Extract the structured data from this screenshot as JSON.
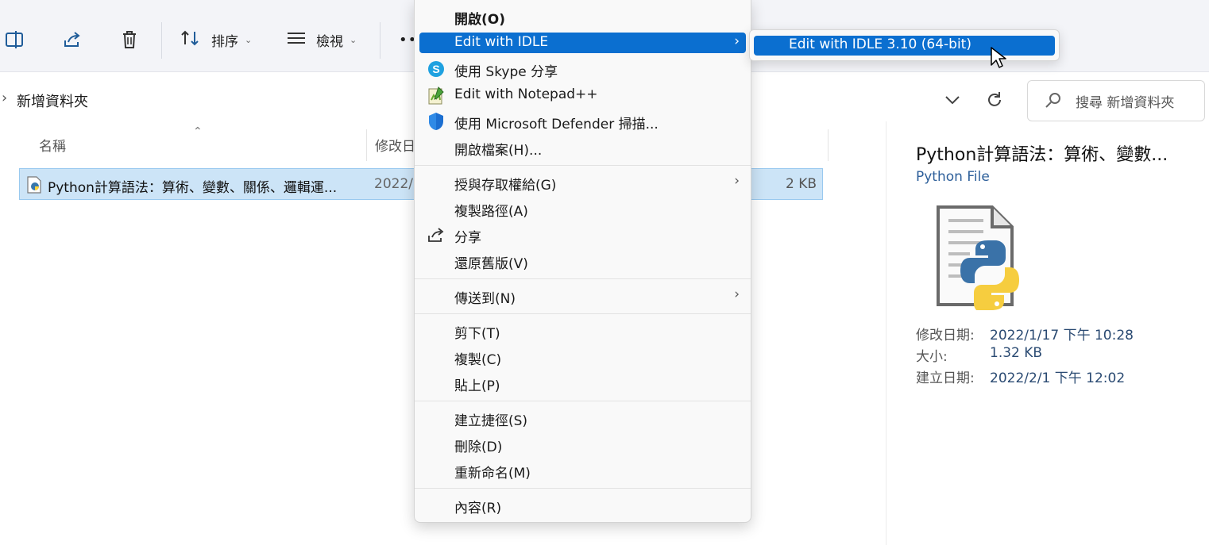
{
  "toolbar": {
    "sort_label": "排序",
    "view_label": "檢視",
    "more_label": "••"
  },
  "address": {
    "separator": "›",
    "path": "新增資料夾"
  },
  "search": {
    "placeholder": "搜尋 新增資料夾"
  },
  "columns": {
    "name": "名稱",
    "modified": "修改日"
  },
  "file": {
    "name": "Python計算語法：算術、變數、關係、邏輯運...",
    "date": "2022/",
    "size": "2 KB"
  },
  "context_menu": {
    "items": [
      {
        "label": "開啟(O)"
      },
      {
        "label": "Edit with IDLE"
      },
      {
        "label": "使用 Skype 分享"
      },
      {
        "label": "Edit with Notepad++"
      },
      {
        "label": "使用 Microsoft Defender 掃描..."
      },
      {
        "label": "開啟檔案(H)..."
      },
      {
        "label": "授與存取權給(G)"
      },
      {
        "label": "複製路徑(A)"
      },
      {
        "label": "分享"
      },
      {
        "label": "還原舊版(V)"
      },
      {
        "label": "傳送到(N)"
      },
      {
        "label": "剪下(T)"
      },
      {
        "label": "複製(C)"
      },
      {
        "label": "貼上(P)"
      },
      {
        "label": "建立捷徑(S)"
      },
      {
        "label": "刪除(D)"
      },
      {
        "label": "重新命名(M)"
      },
      {
        "label": "內容(R)"
      }
    ],
    "submenu_arrow": "›"
  },
  "submenu": {
    "item": "Edit with IDLE 3.10 (64-bit)"
  },
  "preview": {
    "title": "Python計算語法：算術、變數...",
    "type": "Python File",
    "modified_key": "修改日期:",
    "modified_val": "2022/1/17 下午 10:28",
    "size_key": "大小:",
    "size_val": "1.32 KB",
    "created_key": "建立日期:",
    "created_val": "2022/2/1 下午 12:02"
  },
  "colors": {
    "highlight": "#0b6fd0",
    "selection": "#cce4f7",
    "toolbar_bg": "#f3f4f8"
  }
}
